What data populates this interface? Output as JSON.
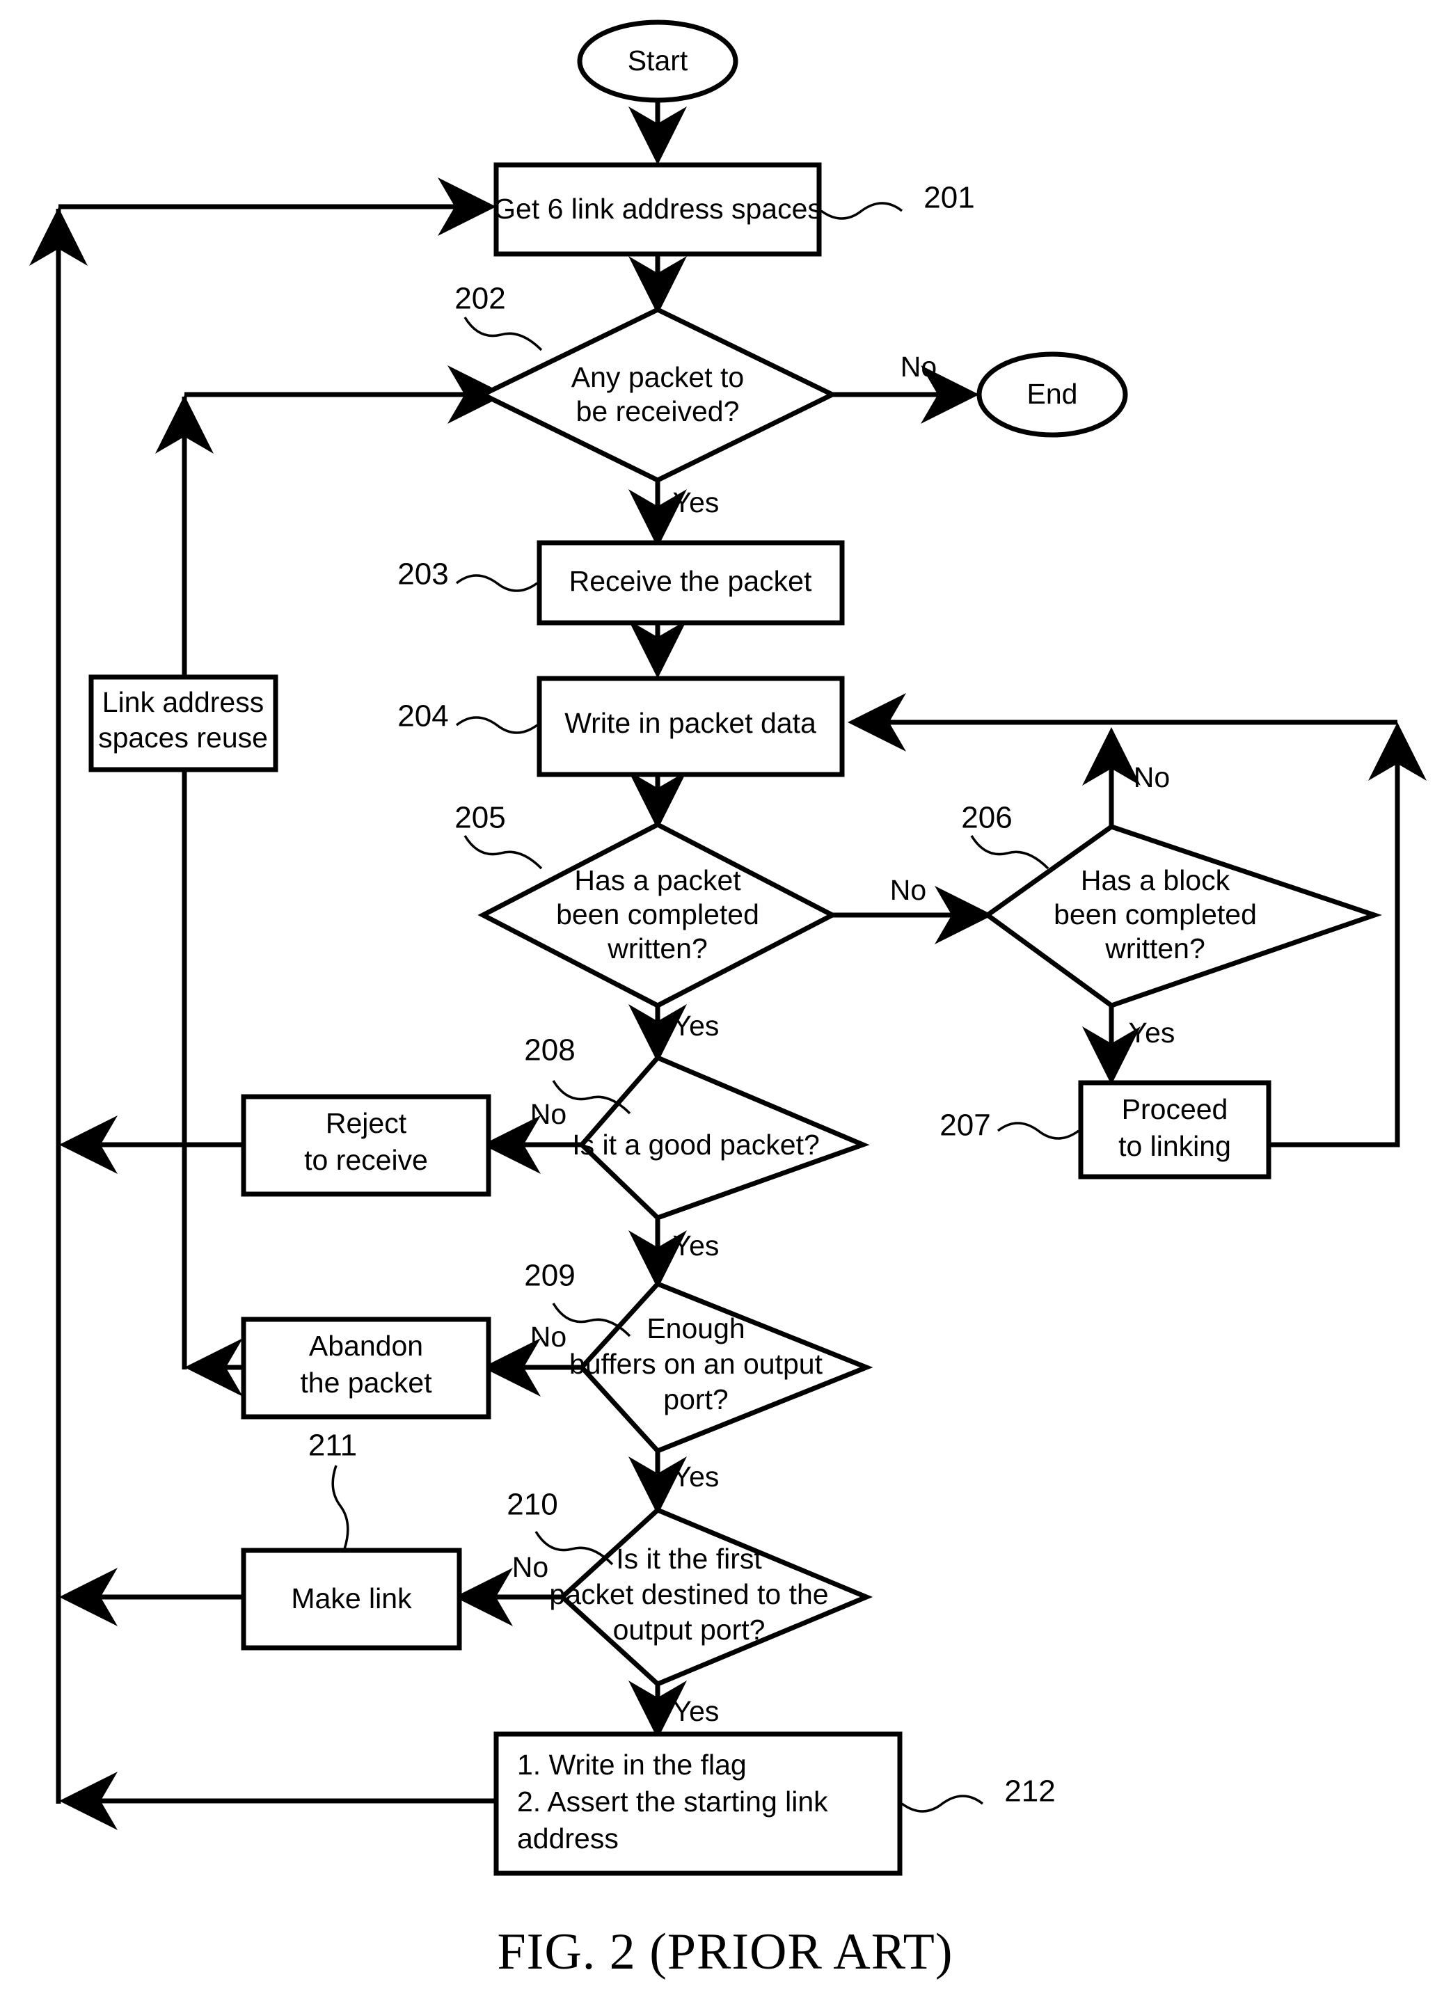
{
  "figure": {
    "caption": "FIG. 2  (PRIOR ART)",
    "type": "flowchart",
    "background_color": "#ffffff",
    "line_color": "#000000"
  },
  "nodes": {
    "start": {
      "ref": "",
      "shape": "ellipse",
      "lines": [
        "Start"
      ]
    },
    "end": {
      "ref": "",
      "shape": "ellipse",
      "lines": [
        "End"
      ]
    },
    "n201": {
      "ref": "201",
      "shape": "process",
      "lines": [
        "Get 6 link address spaces"
      ]
    },
    "n202": {
      "ref": "202",
      "shape": "decision",
      "lines": [
        "Any packet to",
        "be received?"
      ]
    },
    "n203": {
      "ref": "203",
      "shape": "process",
      "lines": [
        "Receive the packet"
      ]
    },
    "n204": {
      "ref": "204",
      "shape": "process",
      "lines": [
        "Write in packet data"
      ]
    },
    "n205": {
      "ref": "205",
      "shape": "decision",
      "lines": [
        "Has a packet",
        "been completed",
        "written?"
      ]
    },
    "n206": {
      "ref": "206",
      "shape": "decision",
      "lines": [
        "Has a block",
        "been completed",
        "written?"
      ]
    },
    "n207": {
      "ref": "207",
      "shape": "process",
      "lines": [
        "Proceed",
        "to linking"
      ]
    },
    "n208": {
      "ref": "208",
      "shape": "decision",
      "lines": [
        "Is it a good packet?"
      ]
    },
    "n209": {
      "ref": "209",
      "shape": "decision",
      "lines": [
        "Enough",
        "buffers on an output",
        "port?"
      ]
    },
    "n210": {
      "ref": "210",
      "shape": "decision",
      "lines": [
        "Is it the first",
        "packet destined to the",
        "output port?"
      ]
    },
    "n211": {
      "ref": "211",
      "shape": "process",
      "lines": [
        "Make link"
      ]
    },
    "n212": {
      "ref": "212",
      "shape": "process",
      "lines": [
        "1. Write in the flag",
        "2. Assert the starting link",
        "    address"
      ]
    },
    "reuse": {
      "ref": "",
      "shape": "process",
      "lines": [
        "Link address",
        "spaces reuse"
      ]
    },
    "reject": {
      "ref": "",
      "shape": "process",
      "lines": [
        "Reject",
        "to receive"
      ]
    },
    "abandon": {
      "ref": "",
      "shape": "process",
      "lines": [
        "Abandon",
        "the packet"
      ]
    }
  },
  "edge_labels": {
    "e202_no": "No",
    "e202_yes": "Yes",
    "e205_no": "No",
    "e205_yes": "Yes",
    "e206_no": "No",
    "e206_yes": "Yes",
    "e208_no": "No",
    "e208_yes": "Yes",
    "e209_no": "No",
    "e209_yes": "Yes",
    "e210_no": "No",
    "e210_yes": "Yes"
  },
  "flow_edges": [
    {
      "from": "start",
      "to": "n201",
      "label": ""
    },
    {
      "from": "n201",
      "to": "n202",
      "label": ""
    },
    {
      "from": "n202",
      "to": "end",
      "label": "No"
    },
    {
      "from": "n202",
      "to": "n203",
      "label": "Yes"
    },
    {
      "from": "n203",
      "to": "n204",
      "label": ""
    },
    {
      "from": "n204",
      "to": "n205",
      "label": ""
    },
    {
      "from": "n205",
      "to": "n206",
      "label": "No"
    },
    {
      "from": "n205",
      "to": "n208",
      "label": "Yes"
    },
    {
      "from": "n206",
      "to": "n204",
      "label": "No"
    },
    {
      "from": "n206",
      "to": "n207",
      "label": "Yes"
    },
    {
      "from": "n207",
      "to": "n204",
      "label": ""
    },
    {
      "from": "n208",
      "to": "reject",
      "label": "No"
    },
    {
      "from": "n208",
      "to": "n209",
      "label": "Yes"
    },
    {
      "from": "reject",
      "to": "n201",
      "label": ""
    },
    {
      "from": "n209",
      "to": "abandon",
      "label": "No"
    },
    {
      "from": "n209",
      "to": "n210",
      "label": "Yes"
    },
    {
      "from": "abandon",
      "to": "n202",
      "label": ""
    },
    {
      "from": "n210",
      "to": "n211",
      "label": "No"
    },
    {
      "from": "n210",
      "to": "n212",
      "label": "Yes"
    },
    {
      "from": "n211",
      "to": "n201",
      "label": ""
    },
    {
      "from": "n212",
      "to": "n201",
      "label": ""
    },
    {
      "from": "reuse",
      "to": "n202",
      "label": ""
    }
  ]
}
